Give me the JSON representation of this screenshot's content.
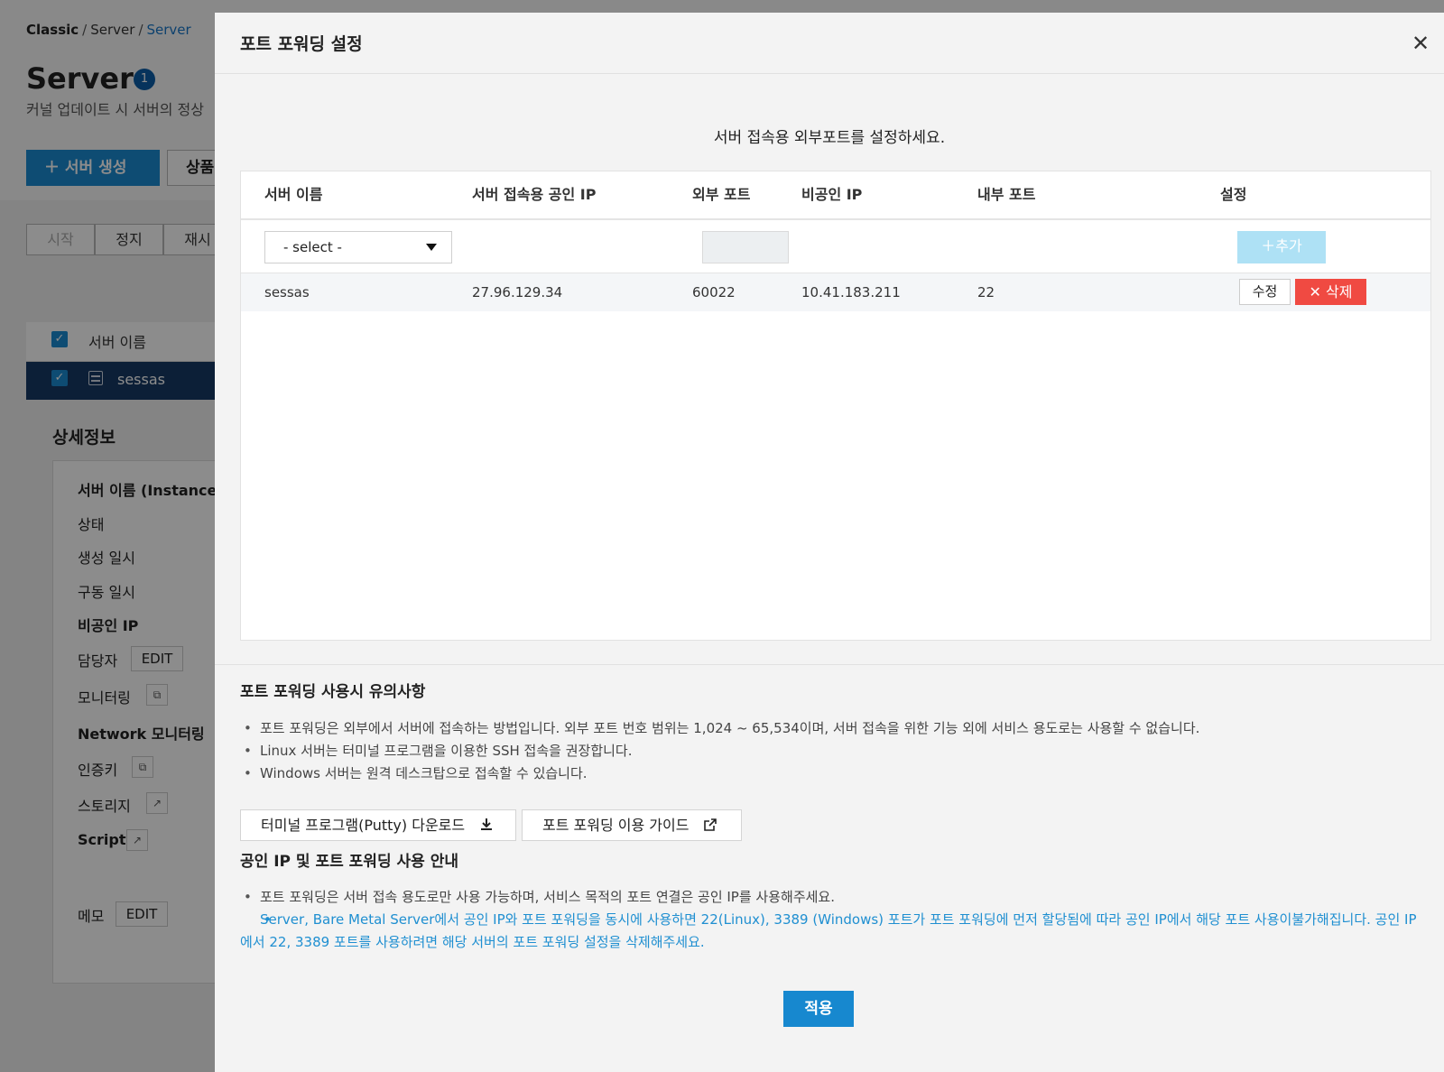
{
  "background": {
    "breadcrumb": [
      "Classic",
      "Server",
      "Server"
    ],
    "title": "Server",
    "badge": "1",
    "description": "커널 업데이트 시 서버의 정상",
    "create_button": "＋ 서버 생성",
    "product_button": "상품",
    "action_tabs": [
      "시작",
      "정지",
      "재시"
    ],
    "server_list": {
      "header": "서버 이름",
      "rows": [
        "sessas"
      ]
    },
    "detail": {
      "title": "상세정보",
      "items": [
        "서버 이름 (Instance I",
        "상태",
        "생성 일시",
        "구동 일시",
        "비공인 IP",
        "담당자",
        "모니터링",
        "Network 모니터링",
        "인증키",
        "스토리지",
        "Script",
        "메모"
      ],
      "edit_label": "EDIT"
    }
  },
  "modal": {
    "title": "포트 포워딩 설정",
    "instruction": "서버 접속용 외부포트를 설정하세요.",
    "table": {
      "columns": [
        "서버 이름",
        "서버 접속용 공인 IP",
        "외부 포트",
        "비공인 IP",
        "내부 포트",
        "설정"
      ],
      "select_value": "- select -",
      "port_input_value": "",
      "add_label": "＋추가",
      "rows": [
        {
          "server": "sessas",
          "public_ip": "27.96.129.34",
          "ext_port": "60022",
          "private_ip": "10.41.183.211",
          "int_port": "22"
        }
      ],
      "edit_label": "수정",
      "delete_label": "✕ 삭제"
    },
    "notes": {
      "title": "포트 포워딩 사용시 유의사항",
      "items": [
        "포트 포워딩은 외부에서 서버에 접속하는 방법입니다. 외부 포트 번호 범위는 1,024 ~ 65,534이며, 서버 접속을 위한 기능 외에 서비스 용도로는 사용할 수 없습니다.",
        "Linux 서버는 터미널 프로그램을 이용한 SSH 접속을 권장합니다.",
        "Windows 서버는 원격 데스크탑으로 접속할 수 있습니다."
      ],
      "putty_button": "터미널 프로그램(Putty) 다운로드",
      "guide_button": "포트 포워딩 이용 가이드"
    },
    "public_ip": {
      "title": "공인 IP 및 포트 포워딩 사용 안내",
      "items": [
        "포트 포워딩은 서버 접속 용도로만 사용 가능하며, 서비스 목적의 포트 연결은 공인 IP를 사용해주세요.",
        "Server, Bare Metal Server에서 공인 IP와 포트 포워딩을 동시에 사용하면 22(Linux), 3389 (Windows) 포트가 포트 포워딩에 먼저 할당됨에 따라 공인 IP에서 해당 포트 사용이불가해집니다. 공인 IP에서 22, 3389 포트를 사용하려면 해당 서버의 포트 포워딩 설정을 삭제해주세요."
      ]
    },
    "apply_label": "적용",
    "close_icon": "close-icon"
  },
  "colors": {
    "primary": "#1788cf",
    "danger": "#f04a42",
    "add_disabled": "#aee1f5",
    "notice_blue": "#1f8fd1"
  }
}
